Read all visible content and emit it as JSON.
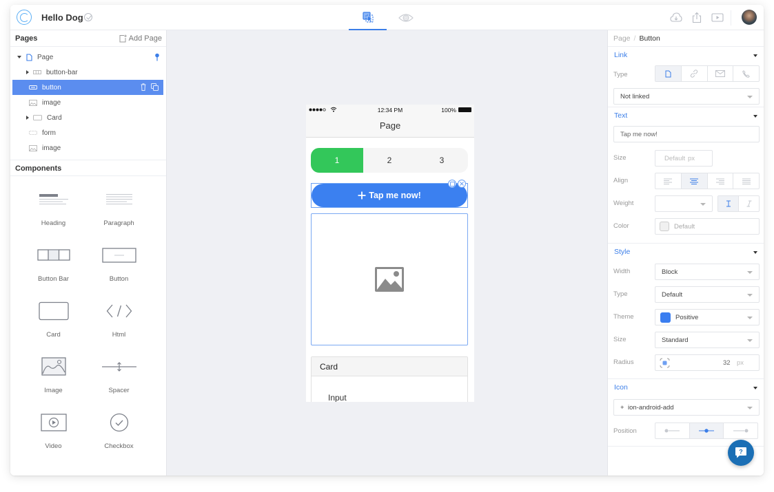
{
  "app": {
    "title": "Hello Dog",
    "accent_color": "#3b7ee8"
  },
  "topbar": {
    "modes": [
      {
        "name": "design",
        "icon": "select-cursor-icon",
        "active": true
      },
      {
        "name": "preview",
        "icon": "eye-icon",
        "active": false
      }
    ],
    "actions": [
      {
        "icon": "cloud-download-icon"
      },
      {
        "icon": "share-icon"
      },
      {
        "icon": "play-icon"
      }
    ]
  },
  "pages_panel": {
    "title": "Pages",
    "add_page_label": "Add Page",
    "tree": [
      {
        "label": "Page",
        "icon": "page-icon",
        "expanded": true,
        "level": 0
      },
      {
        "label": "button-bar",
        "icon": "button-bar-icon",
        "collapsed": true,
        "level": 1
      },
      {
        "label": "button",
        "icon": "button-icon",
        "selected": true,
        "level": 1
      },
      {
        "label": "image",
        "icon": "image-icon",
        "level": 1
      },
      {
        "label": "Card",
        "icon": "card-icon",
        "collapsed": true,
        "level": 1
      },
      {
        "label": "form",
        "icon": "form-icon",
        "level": 1
      },
      {
        "label": "image",
        "icon": "image-icon",
        "level": 1
      }
    ]
  },
  "components_panel": {
    "title": "Components",
    "items": [
      {
        "label": "Heading",
        "icon": "heading-icon"
      },
      {
        "label": "Paragraph",
        "icon": "paragraph-icon"
      },
      {
        "label": "Button Bar",
        "icon": "button-bar-icon"
      },
      {
        "label": "Button",
        "icon": "button-icon"
      },
      {
        "label": "Card",
        "icon": "card-icon"
      },
      {
        "label": "Html",
        "icon": "code-icon"
      },
      {
        "label": "Image",
        "icon": "image-icon"
      },
      {
        "label": "Spacer",
        "icon": "spacer-icon"
      },
      {
        "label": "Video",
        "icon": "video-icon"
      },
      {
        "label": "Checkbox",
        "icon": "checkbox-icon"
      }
    ]
  },
  "phone": {
    "status_time": "12:34 PM",
    "battery": "100%",
    "nav_title": "Page",
    "segments": [
      "1",
      "2",
      "3"
    ],
    "active_segment": 0,
    "button_label": "Tap me now!",
    "button_color": "#3b80f0",
    "segment_active_color": "#33c75a",
    "card_title": "Card",
    "card_input_label": "Input"
  },
  "inspector": {
    "breadcrumb": {
      "parent": "Page",
      "separator": "/",
      "current": "Button"
    },
    "link": {
      "title": "Link",
      "type_label": "Type",
      "type_options": [
        "page-icon",
        "link-icon",
        "mail-icon",
        "phone-icon"
      ],
      "type_selected": 0,
      "target_value": "Not linked"
    },
    "text": {
      "title": "Text",
      "text_value": "Tap me now!",
      "size_label": "Size",
      "size_placeholder": "Default",
      "size_unit": "px",
      "align_label": "Align",
      "align_options": [
        "left",
        "center",
        "right",
        "justify"
      ],
      "align_selected": 1,
      "weight_label": "Weight",
      "weight_value": "",
      "style_options": [
        "normal",
        "italic"
      ],
      "style_selected": 0,
      "color_label": "Color",
      "color_value": "Default"
    },
    "style": {
      "title": "Style",
      "width_label": "Width",
      "width_value": "Block",
      "type_label": "Type",
      "type_value": "Default",
      "theme_label": "Theme",
      "theme_value": "Positive",
      "theme_color": "#3b7ef0",
      "size_label": "Size",
      "size_value": "Standard",
      "radius_label": "Radius",
      "radius_value": "32",
      "radius_unit": "px"
    },
    "icon": {
      "title": "Icon",
      "icon_value": "ion-android-add",
      "position_label": "Position",
      "position_options": [
        "left",
        "center",
        "right"
      ],
      "position_selected": 1
    }
  },
  "help_button": {
    "icon": "help-chat-icon",
    "label": "?"
  }
}
